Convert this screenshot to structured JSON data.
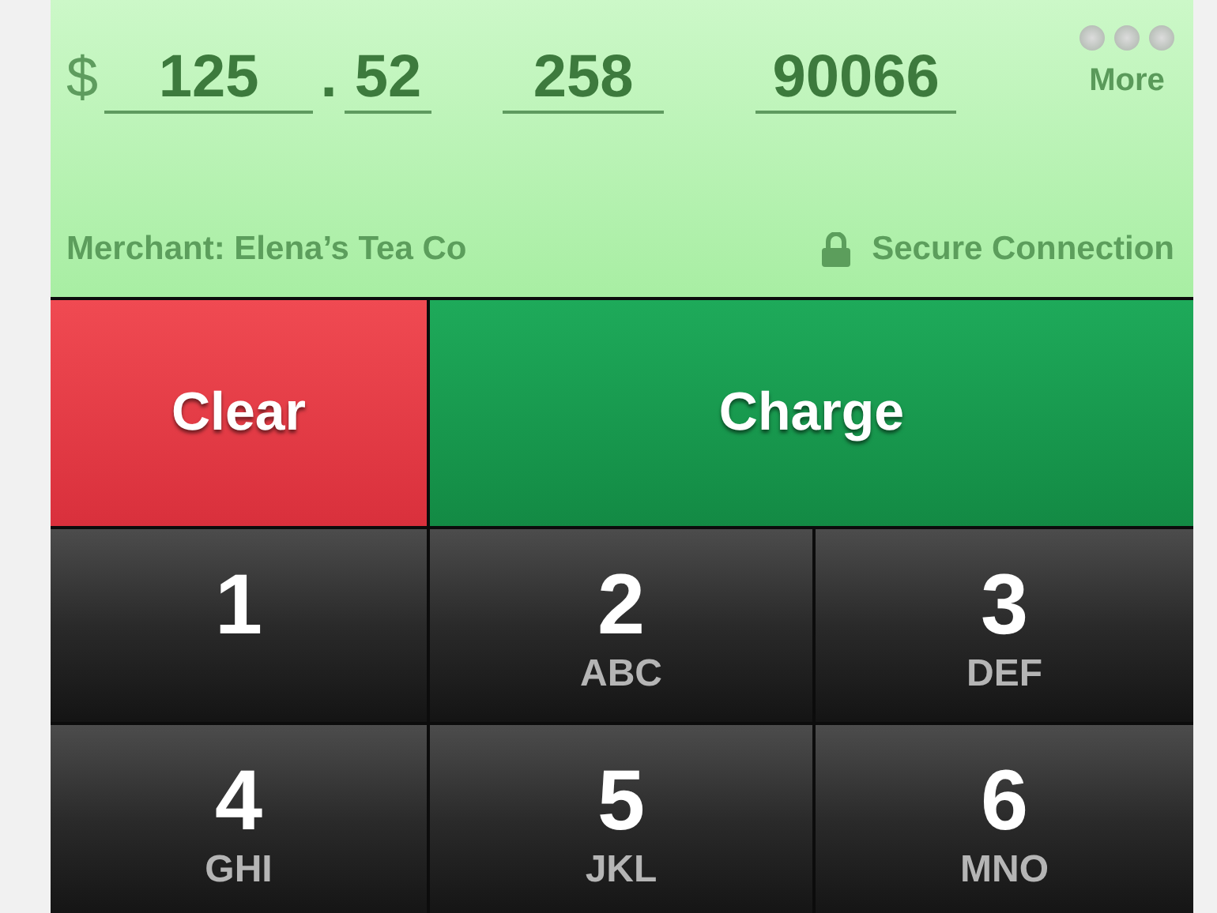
{
  "amount": {
    "currency": "$",
    "dollars": "125",
    "separator": ".",
    "cents": "52"
  },
  "extra_fields": [
    "258",
    "90066"
  ],
  "more": {
    "label": "More"
  },
  "merchant": "Merchant: Elena’s Tea Co",
  "secure": "Secure Connection",
  "actions": [
    {
      "label": "Clear",
      "kind": "clear"
    },
    {
      "label": "Charge",
      "kind": "charge"
    }
  ],
  "keys": [
    {
      "digit": "1"
    },
    {
      "digit": "2",
      "letters": "ABC"
    },
    {
      "digit": "3",
      "letters": "DEF"
    },
    {
      "digit": "4",
      "letters": "GHI"
    },
    {
      "digit": "5",
      "letters": "JKL"
    },
    {
      "digit": "6",
      "letters": "MNO"
    }
  ]
}
